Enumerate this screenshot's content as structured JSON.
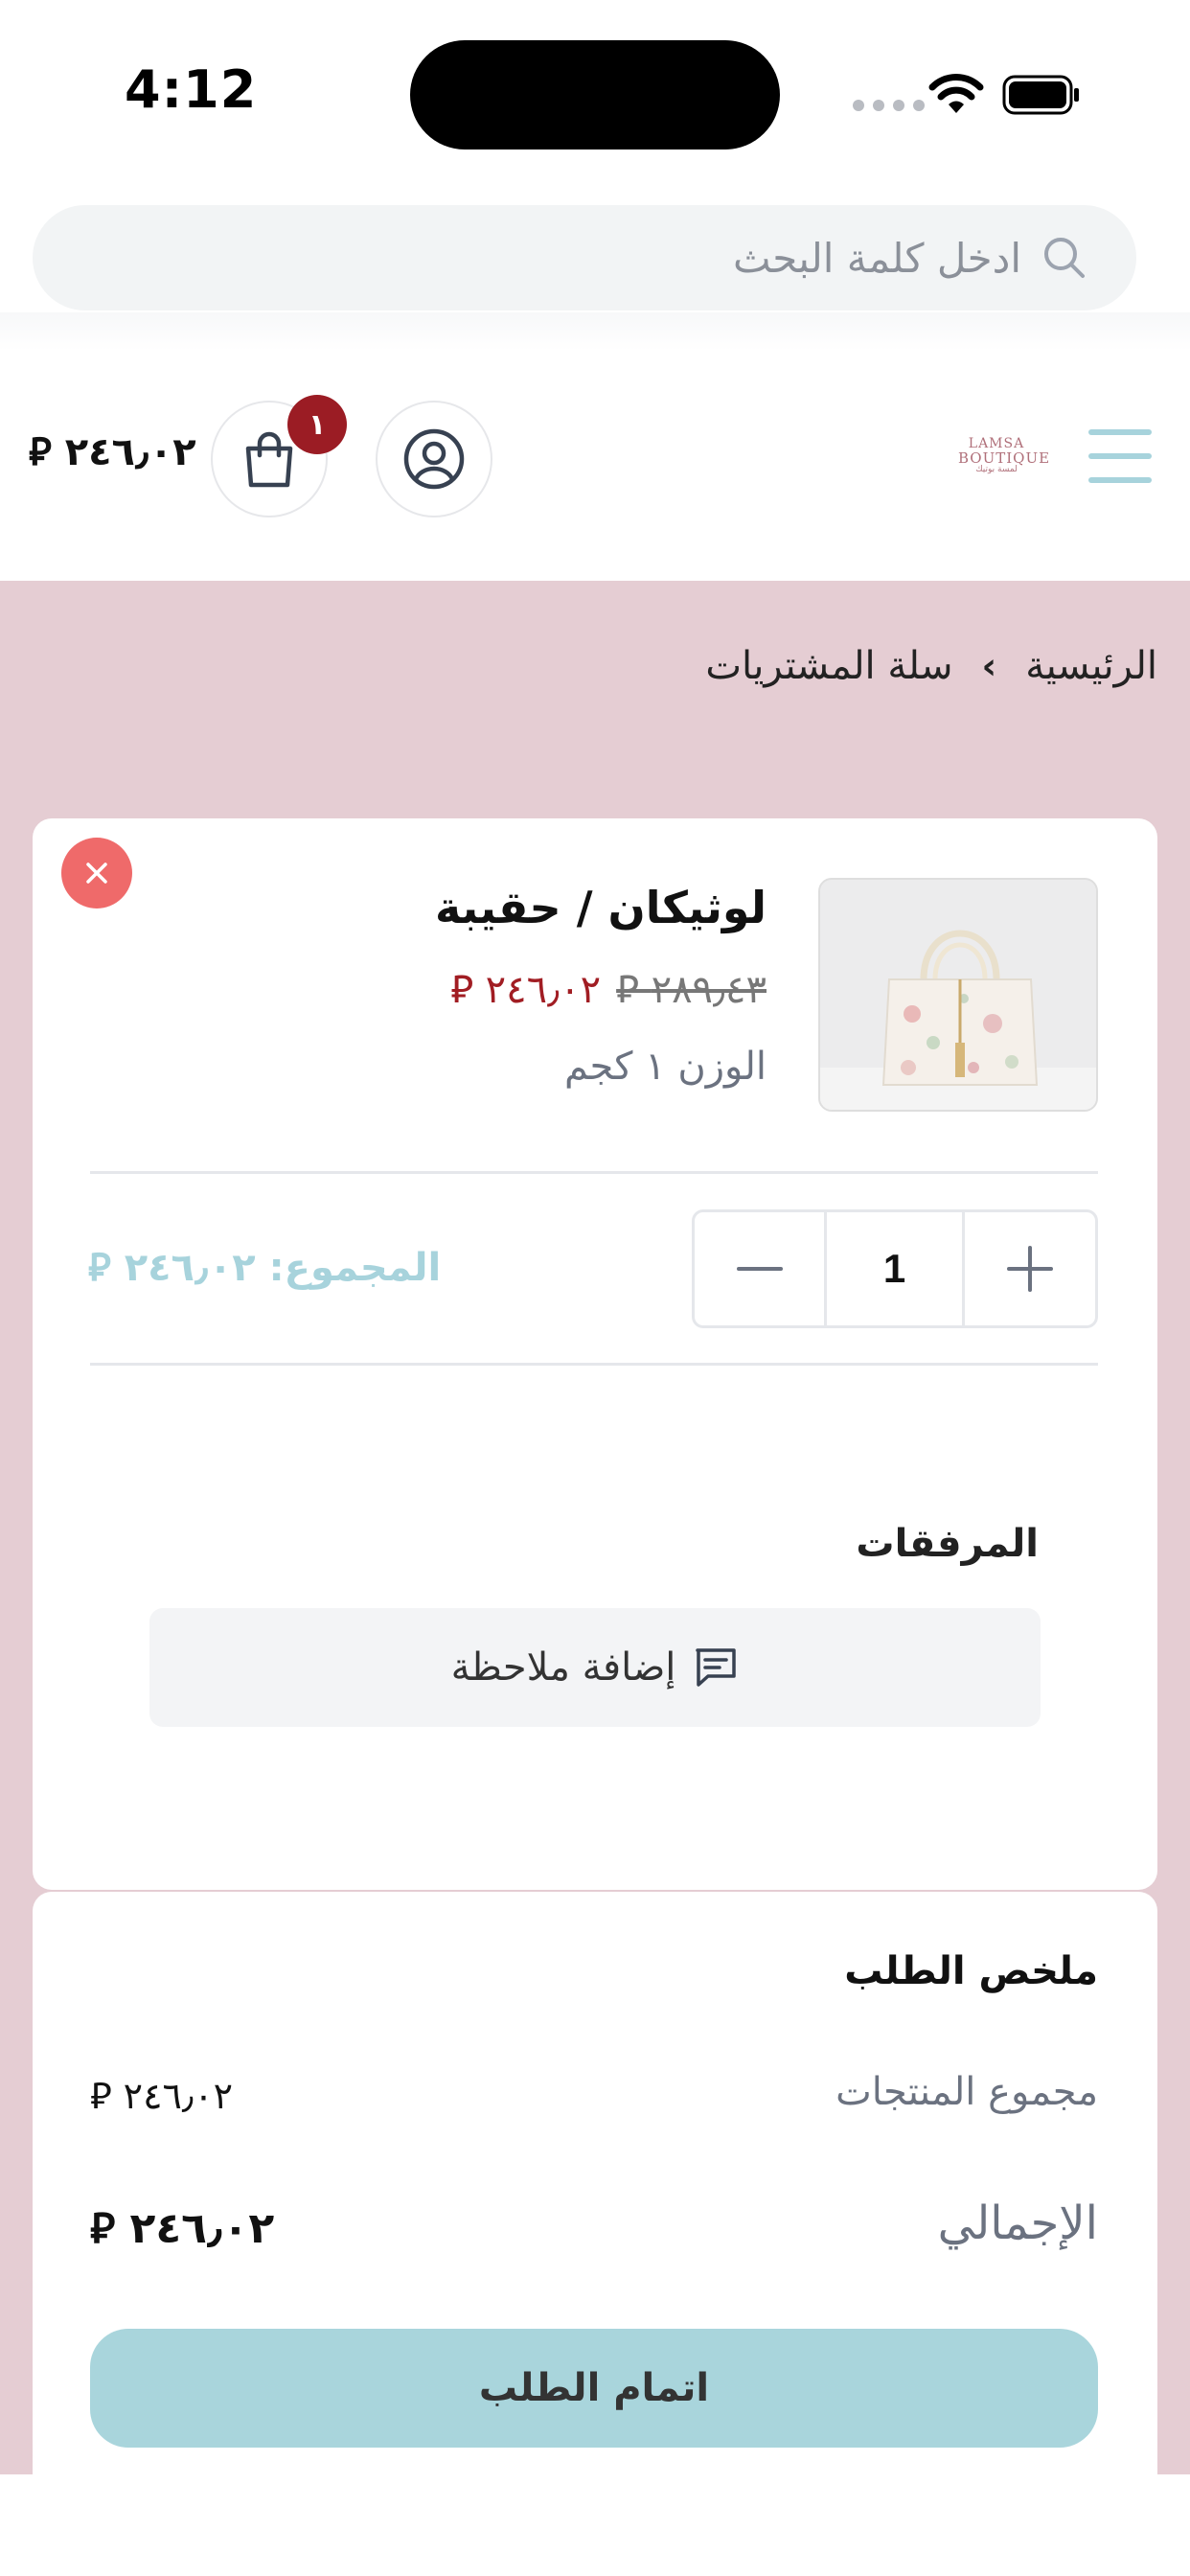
{
  "status_bar": {
    "time": "4:12"
  },
  "search": {
    "placeholder": "ادخل كلمة البحث"
  },
  "header": {
    "cart_total": "٢٤٦٫٠٢ ⃁",
    "cart_count": "١",
    "logo_line1": "LAMSA",
    "logo_line2": "BOUTIQUE",
    "logo_line3": "لمسة بوتيك"
  },
  "breadcrumb": {
    "home": "الرئيسية",
    "separator": "›",
    "current": "سلة المشتريات"
  },
  "cart_item": {
    "name": "لوثيكان / حقيبة",
    "old_price": "٢٨٩٫٤٣ ⃁",
    "new_price": "٢٤٦٫٠٢ ⃁",
    "weight": "الوزن ١ كجم",
    "quantity": "1",
    "subtotal": "المجموع: ٢٤٦٫٠٢ ⃁"
  },
  "attachments": {
    "title": "المرفقات",
    "add_note_label": "إضافة ملاحظة"
  },
  "summary": {
    "title": "ملخص الطلب",
    "products_total_label": "مجموع المنتجات",
    "products_total_value": "٢٤٦٫٠٢ ⃁",
    "grand_total_label": "الإجمالي",
    "grand_total_value": "٢٤٦٫٠٢ ⃁",
    "checkout_label": "اتمام الطلب"
  },
  "colors": {
    "accent": "#a9d5dc",
    "sale_red": "#a11d23",
    "badge": "#9b1c24",
    "remove": "#ef6a6a",
    "page_bg_pink": "#e5cdd3"
  },
  "icons": {
    "search": "search-icon",
    "cart": "shopping-bag-icon",
    "account": "user-circle-icon",
    "menu": "hamburger-menu-icon",
    "remove": "close-icon",
    "note": "message-square-icon",
    "minus": "minus-icon",
    "plus": "plus-icon"
  }
}
